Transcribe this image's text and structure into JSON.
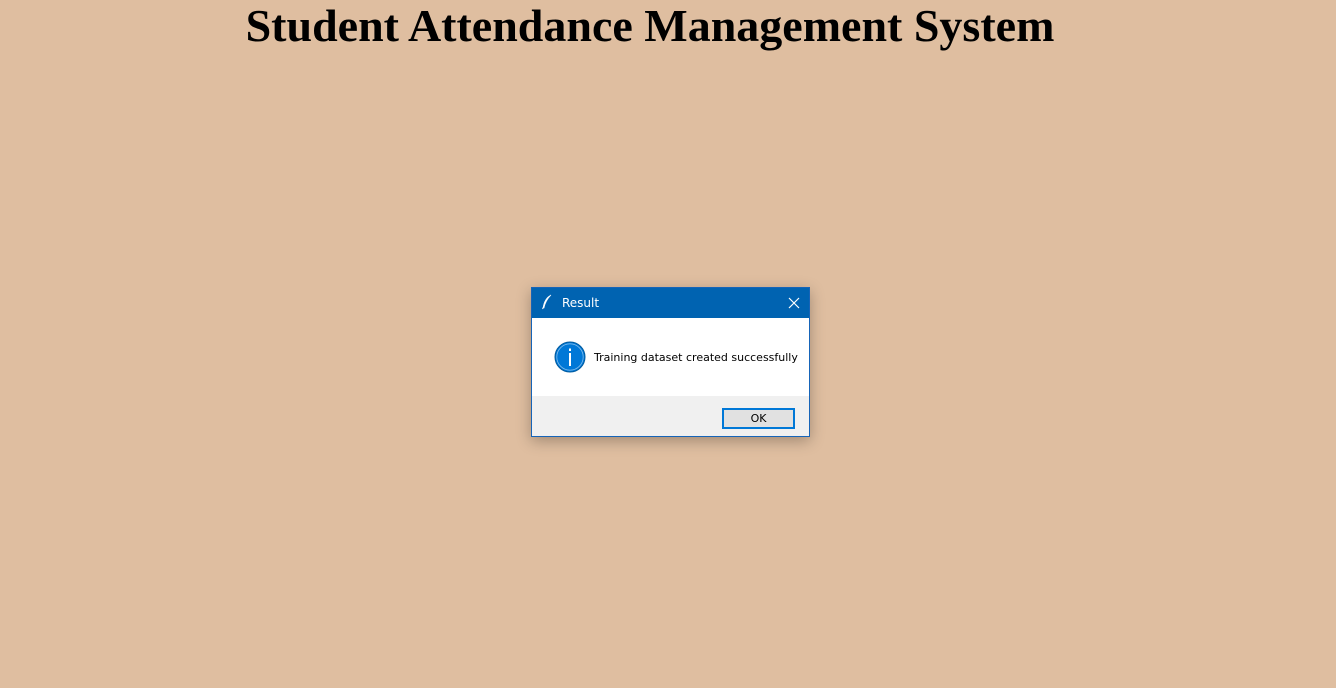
{
  "app": {
    "title": "Student Attendance Management System",
    "background_color": "#dfbea0"
  },
  "dialog": {
    "title": "Result",
    "message": "Training dataset created successfully",
    "ok_label": "OK",
    "icons": {
      "window": "feather-icon",
      "close": "close-icon",
      "info": "info-icon"
    },
    "colors": {
      "titlebar": "#0063b1",
      "info_icon": "#0078d7",
      "button_border": "#0078d7"
    }
  }
}
